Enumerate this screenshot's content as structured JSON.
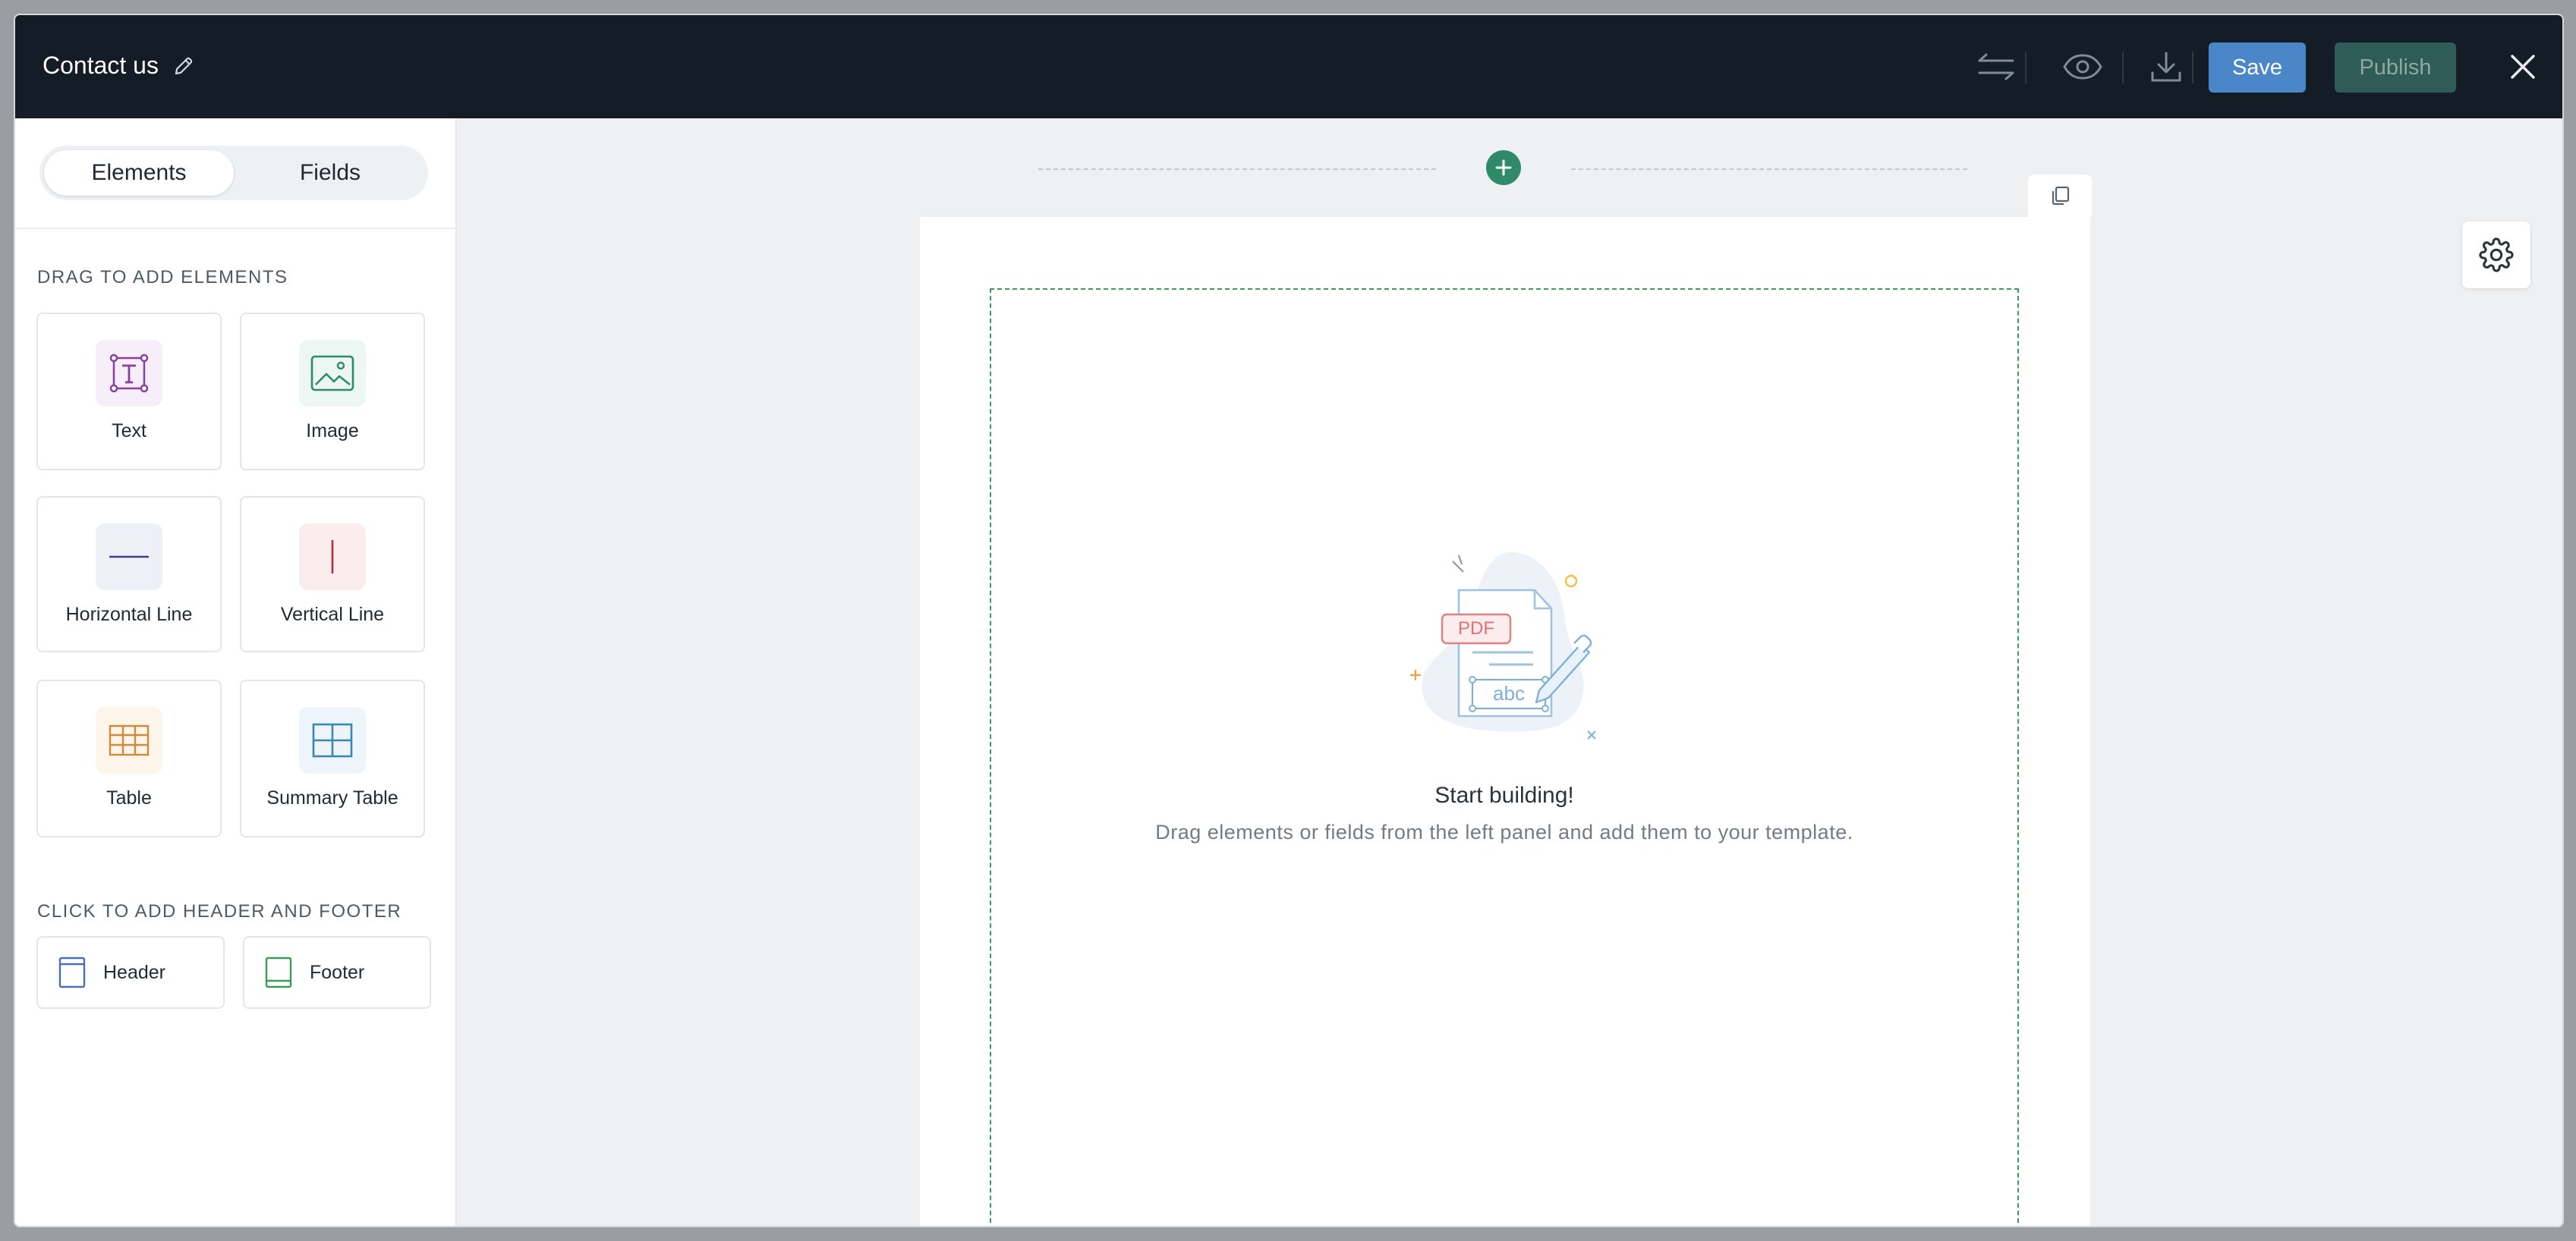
{
  "header": {
    "title": "Contact us",
    "save_label": "Save",
    "publish_label": "Publish",
    "icons": [
      "edit-icon",
      "swap-arrows-icon",
      "eye-icon",
      "download-icon",
      "close-icon"
    ]
  },
  "sidebar": {
    "tabs": [
      {
        "label": "Elements",
        "active": true
      },
      {
        "label": "Fields",
        "active": false
      }
    ],
    "elements_heading": "DRAG TO ADD ELEMENTS",
    "elements": [
      {
        "label": "Text",
        "icon": "text-icon",
        "color": "#8a3fa0"
      },
      {
        "label": "Image",
        "icon": "image-icon",
        "color": "#2f8a6a"
      },
      {
        "label": "Horizontal Line",
        "icon": "horizontal-line-icon",
        "color": "#3a3f8f"
      },
      {
        "label": "Vertical Line",
        "icon": "vertical-line-icon",
        "color": "#b0303e"
      },
      {
        "label": "Table",
        "icon": "table-icon",
        "color": "#d08a3a"
      },
      {
        "label": "Summary Table",
        "icon": "summary-table-icon",
        "color": "#3a86b5"
      }
    ],
    "header_footer_heading": "CLICK TO ADD HEADER AND FOOTER",
    "header_footer": [
      {
        "label": "Header",
        "icon": "header-icon",
        "color": "#4a6fb5"
      },
      {
        "label": "Footer",
        "icon": "footer-icon",
        "color": "#3a9a5a"
      }
    ]
  },
  "canvas": {
    "empty_title": "Start building!",
    "empty_subtitle": "Drag elements or fields from the left panel and add them to your template.",
    "illustration": {
      "pdf_label": "PDF",
      "abc_label": "abc"
    }
  },
  "colors": {
    "topbar": "#141d26",
    "save": "#4a86c8",
    "publish": "#2f5c56",
    "accent_green": "#2f8a6a"
  }
}
